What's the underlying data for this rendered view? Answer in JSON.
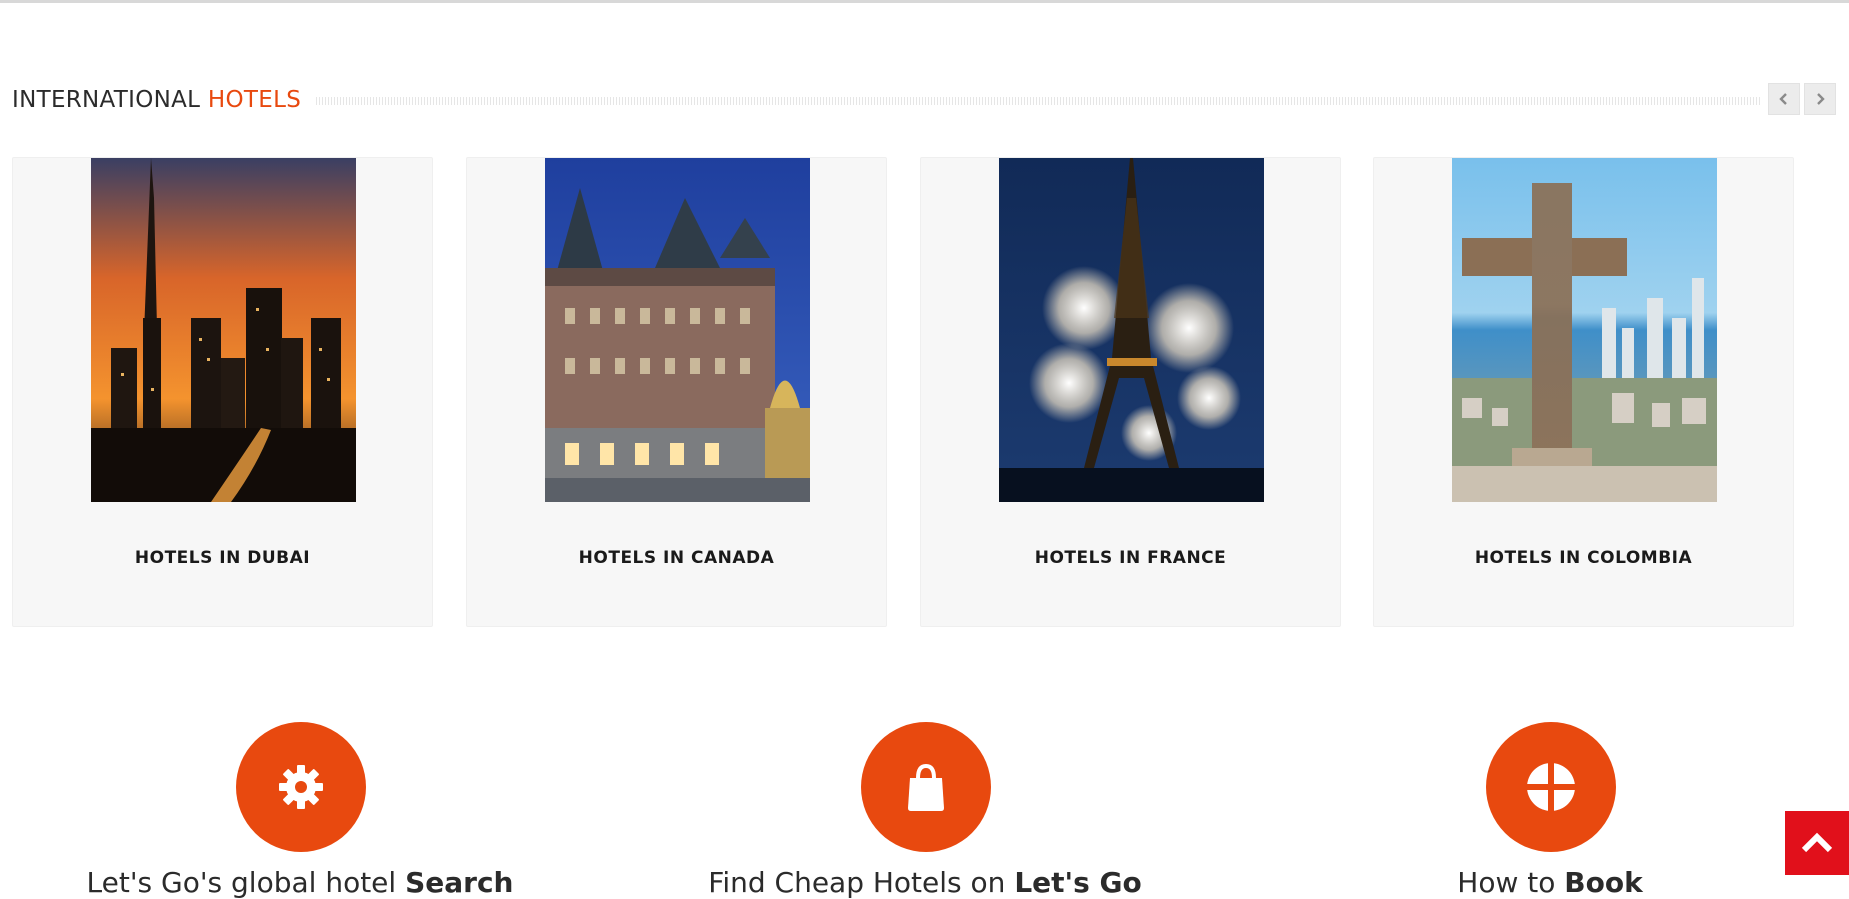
{
  "section": {
    "title_prefix": "INTERNATIONAL",
    "title_highlight": "HOTELS",
    "accent_color": "#e8490f",
    "prev_icon": "chevron-left-icon",
    "next_icon": "chevron-right-icon"
  },
  "cards": [
    {
      "label": "HOTELS IN DUBAI",
      "image": "dubai-skyline-sunset"
    },
    {
      "label": "HOTELS IN CANADA",
      "image": "quebec-chateau-night"
    },
    {
      "label": "HOTELS IN FRANCE",
      "image": "eiffel-tower-fireworks"
    },
    {
      "label": "HOTELS IN COLOMBIA",
      "image": "stone-cross-city-view"
    }
  ],
  "features": [
    {
      "icon": "gear-icon",
      "text_prefix": "Let's Go's global hotel ",
      "text_bold": "Search"
    },
    {
      "icon": "shopping-bag-icon",
      "text_prefix": "Find Cheap Hotels on ",
      "text_bold": "Let's Go"
    },
    {
      "icon": "grid-circle-icon",
      "text_prefix": "How to ",
      "text_bold": "Book"
    }
  ],
  "scroll_top": {
    "icon": "chevron-up-icon",
    "color": "#e1101b"
  }
}
